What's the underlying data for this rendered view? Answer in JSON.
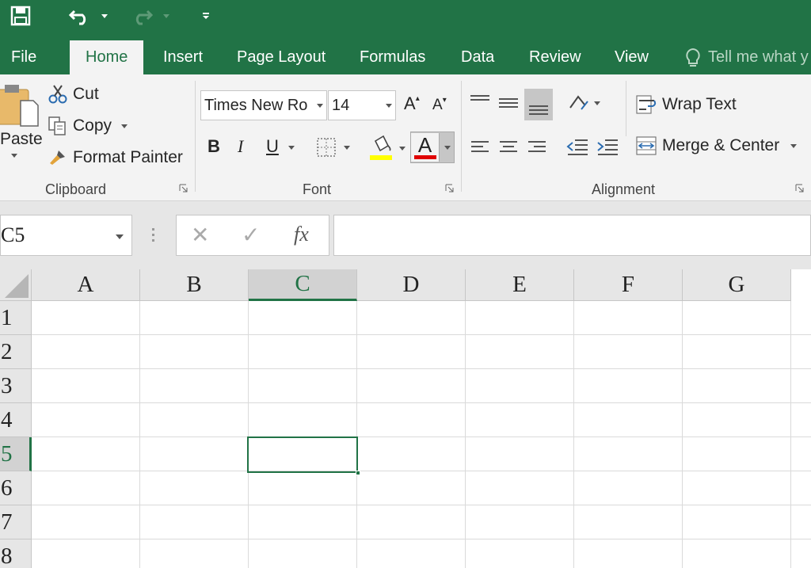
{
  "qat": {
    "save": "save-icon",
    "undo": "undo-icon",
    "redo": "redo-icon",
    "customize": "customize-qat-icon"
  },
  "tabs": {
    "file": "File",
    "home": "Home",
    "insert": "Insert",
    "page_layout": "Page Layout",
    "formulas": "Formulas",
    "data": "Data",
    "review": "Review",
    "view": "View",
    "tell_me": "Tell me what y"
  },
  "ribbon": {
    "clipboard": {
      "paste": "Paste",
      "cut": "Cut",
      "copy": "Copy",
      "format_painter": "Format Painter",
      "label": "Clipboard"
    },
    "font": {
      "font_name": "Times New Ro",
      "font_size": "14",
      "grow": "A",
      "shrink": "A",
      "bold": "B",
      "italic": "I",
      "underline": "U",
      "font_color_letter": "A",
      "label": "Font",
      "highlight_color": "#ffff00",
      "font_color": "#e00000"
    },
    "alignment": {
      "wrap_text": "Wrap Text",
      "merge_center": "Merge & Center",
      "label": "Alignment"
    }
  },
  "formula_bar": {
    "name_box": "C5",
    "cancel": "✕",
    "enter": "✓",
    "fx": "fx",
    "formula": ""
  },
  "grid": {
    "columns": [
      "A",
      "B",
      "C",
      "D",
      "E",
      "F",
      "G"
    ],
    "rows": [
      "1",
      "2",
      "3",
      "4",
      "5",
      "6",
      "7",
      "8"
    ],
    "selected_column": "C",
    "selected_row": "5"
  },
  "colors": {
    "accent": "#217346",
    "ribbon_bg": "#f3f3f3",
    "header_bg": "#e6e6e6"
  }
}
